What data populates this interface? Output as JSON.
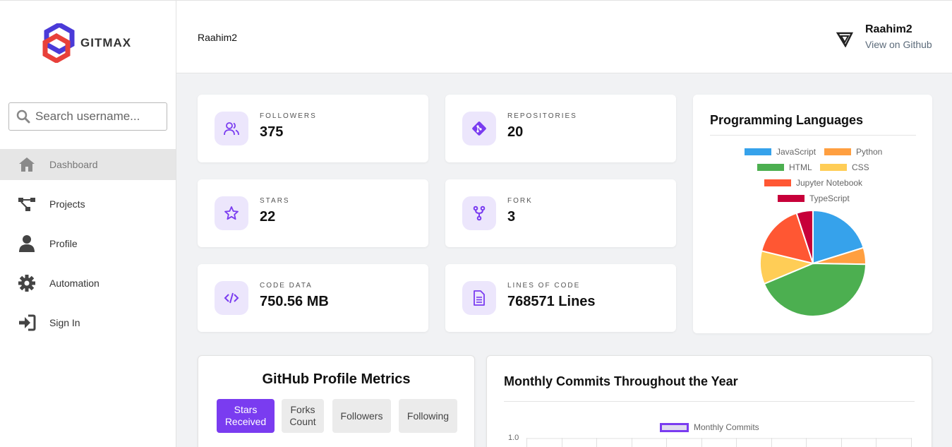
{
  "brand": {
    "name": "GITMAX"
  },
  "search": {
    "placeholder": "Search username..."
  },
  "sidebar": {
    "items": [
      {
        "label": "Dashboard",
        "icon": "home-icon",
        "active": true
      },
      {
        "label": "Projects",
        "icon": "sitemap-icon"
      },
      {
        "label": "Profile",
        "icon": "user-icon"
      },
      {
        "label": "Automation",
        "icon": "gear-icon"
      },
      {
        "label": "Sign In",
        "icon": "sign-in-icon"
      }
    ]
  },
  "header": {
    "breadcrumb": "Raahim2",
    "user_name": "Raahim2",
    "user_link": "View on Github"
  },
  "stats": [
    {
      "label": "FOLLOWERS",
      "value": "375",
      "icon": "users-icon"
    },
    {
      "label": "REPOSITORIES",
      "value": "20",
      "icon": "git-icon"
    },
    {
      "label": "STARS",
      "value": "22",
      "icon": "star-icon"
    },
    {
      "label": "FORK",
      "value": "3",
      "icon": "fork-icon"
    },
    {
      "label": "CODE DATA",
      "value": "750.56 MB",
      "icon": "code-icon"
    },
    {
      "label": "LINES OF CODE",
      "value": "768571 Lines",
      "icon": "file-icon"
    }
  ],
  "languages": {
    "title": "Programming Languages",
    "chart_data": {
      "type": "pie",
      "categories": [
        "JavaScript",
        "Python",
        "HTML",
        "CSS",
        "Jupyter Notebook",
        "TypeScript"
      ],
      "values": [
        20,
        5,
        43,
        10,
        16,
        5
      ],
      "colors": [
        "#36a2eb",
        "#ff9f40",
        "#4caf50",
        "#ffcd56",
        "#ff5733",
        "#c70039"
      ],
      "legend": "top"
    }
  },
  "metrics": {
    "title": "GitHub Profile Metrics",
    "buttons": [
      "Stars Received",
      "Forks Count",
      "Followers",
      "Following"
    ],
    "active": 0
  },
  "commits": {
    "title": "Monthly Commits Throughout the Year",
    "chart_data": {
      "type": "line",
      "series": [
        {
          "name": "Monthly Commits"
        }
      ],
      "y_tick_top": "1.0"
    }
  }
}
